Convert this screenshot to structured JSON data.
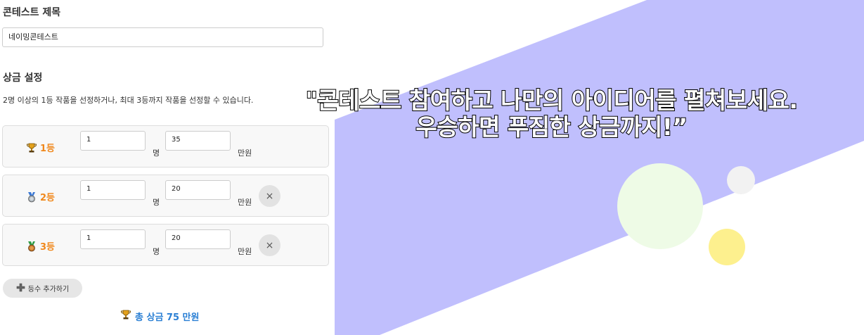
{
  "contest_title": {
    "label": "콘테스트 제목",
    "value": "네이밍콘테스트"
  },
  "prize": {
    "label": "상금 설정",
    "description": "2명 이상의 1등 작품을 선정하거나, 최대 3등까지 작품을 선정할 수 있습니다.",
    "rows": [
      {
        "rank_label": "1등",
        "icon": "trophy-icon",
        "count": "1",
        "count_unit": "명",
        "amount": "35",
        "amount_unit": "만원",
        "removable": false
      },
      {
        "rank_label": "2등",
        "icon": "silver-medal-icon",
        "count": "1",
        "count_unit": "명",
        "amount": "20",
        "amount_unit": "만원",
        "removable": true
      },
      {
        "rank_label": "3등",
        "icon": "bronze-medal-icon",
        "count": "1",
        "count_unit": "명",
        "amount": "20",
        "amount_unit": "만원",
        "removable": true
      }
    ],
    "remove_label": "×",
    "add_label": "등수 추가하기",
    "total_label": "총 상금 75 만원"
  },
  "headline": {
    "line1": "\"콘테스트 참여하고 나만의 아이디어를 펼쳐보세요.",
    "line2": "우승하면 푸짐한 상금까지!”"
  },
  "colors": {
    "accent_purple": "#c0bffd",
    "rank_orange": "#f0881c",
    "total_blue": "#2a7fd4",
    "circle_green": "#eefbe6",
    "circle_yellow": "#fdf08e",
    "circle_gray": "#f2f2f2"
  }
}
